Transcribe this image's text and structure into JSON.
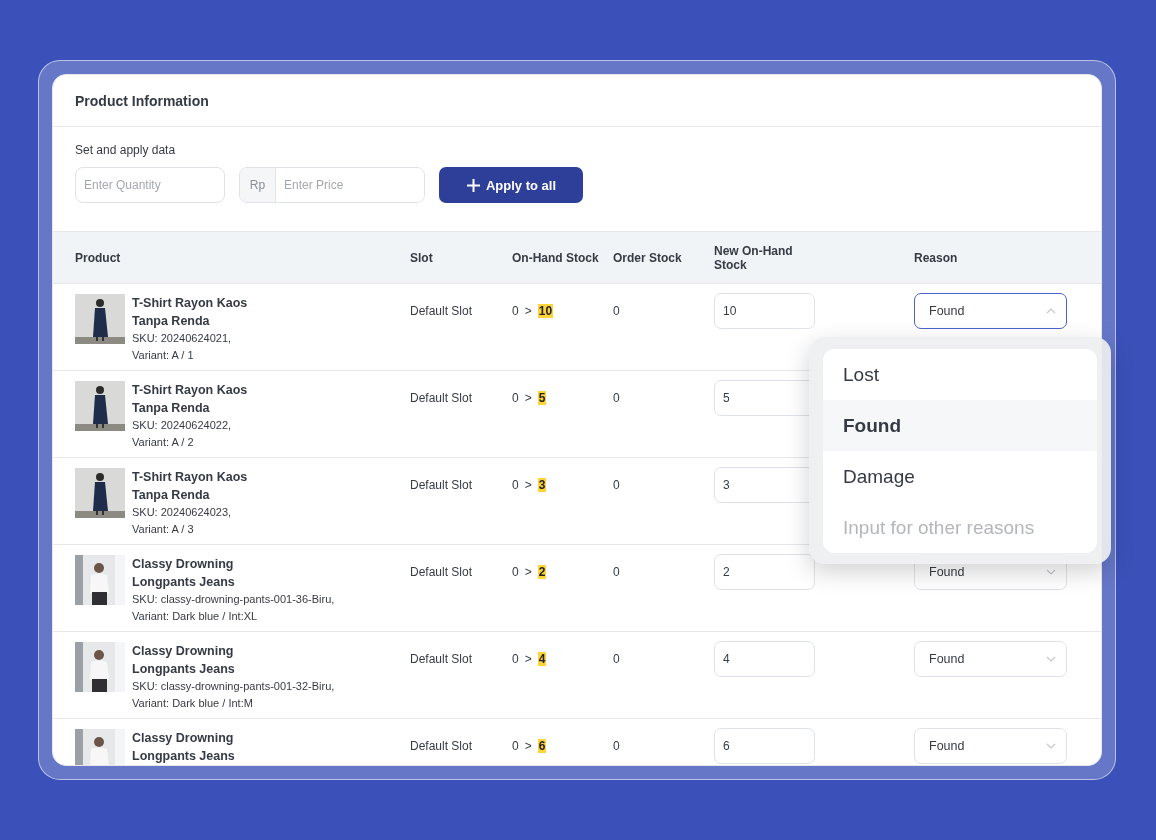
{
  "card": {
    "title": "Product Information"
  },
  "apply": {
    "label": "Set and apply data",
    "quantity_placeholder": "Enter Quantity",
    "currency": "Rp",
    "price_placeholder": "Enter Price",
    "button": "Apply to all"
  },
  "table": {
    "columns": [
      "Product",
      "Slot",
      "On-Hand Stock",
      "Order Stock",
      "New On-Hand Stock",
      "Reason"
    ],
    "rows": [
      {
        "name": "T-Shirt Rayon Kaos Tanpa Renda",
        "sku": "SKU: 20240624021,",
        "variant": "Variant: A / 1",
        "slot": "Default Slot",
        "stock_from": "0",
        "separator": ">",
        "stock_to": "10",
        "order_stock": "0",
        "new_stock": "10",
        "reason": {
          "value": "Found",
          "open": true
        }
      },
      {
        "name": "T-Shirt Rayon Kaos Tanpa Renda",
        "sku": "SKU: 20240624022,",
        "variant": "Variant: A / 2",
        "slot": "Default Slot",
        "stock_from": "0",
        "separator": ">",
        "stock_to": "5",
        "order_stock": "0",
        "new_stock": "5"
      },
      {
        "name": "T-Shirt Rayon Kaos Tanpa Renda",
        "sku": "SKU: 20240624023,",
        "variant": "Variant: A / 3",
        "slot": "Default Slot",
        "stock_from": "0",
        "separator": ">",
        "stock_to": "3",
        "order_stock": "0",
        "new_stock": "3"
      },
      {
        "name": "Classy Drowning Longpants Jeans",
        "sku": "SKU: classy-drowning-pants-001-36-Biru,",
        "variant": "Variant: Dark blue / Int:XL",
        "slot": "Default Slot",
        "stock_from": "0",
        "separator": ">",
        "stock_to": "2",
        "order_stock": "0",
        "new_stock": "2",
        "reason": {
          "value": "Found",
          "open": false
        }
      },
      {
        "name": "Classy Drowning Longpants Jeans",
        "sku": "SKU: classy-drowning-pants-001-32-Biru,",
        "variant": "Variant: Dark blue / Int:M",
        "slot": "Default Slot",
        "stock_from": "0",
        "separator": ">",
        "stock_to": "4",
        "order_stock": "0",
        "new_stock": "4",
        "reason": {
          "value": "Found",
          "open": false
        }
      },
      {
        "name": "Classy Drowning Longpants Jeans",
        "slot": "Default Slot",
        "stock_from": "0",
        "separator": ">",
        "stock_to": "6",
        "order_stock": "0",
        "new_stock": "6",
        "reason": {
          "value": "Found",
          "open": false
        }
      }
    ]
  },
  "dropdown": {
    "options": [
      {
        "label": "Lost",
        "selected": false
      },
      {
        "label": "Found",
        "selected": true
      },
      {
        "label": "Damage",
        "selected": false
      }
    ],
    "other_input": {
      "placeholder": "Input for other reasons"
    }
  }
}
